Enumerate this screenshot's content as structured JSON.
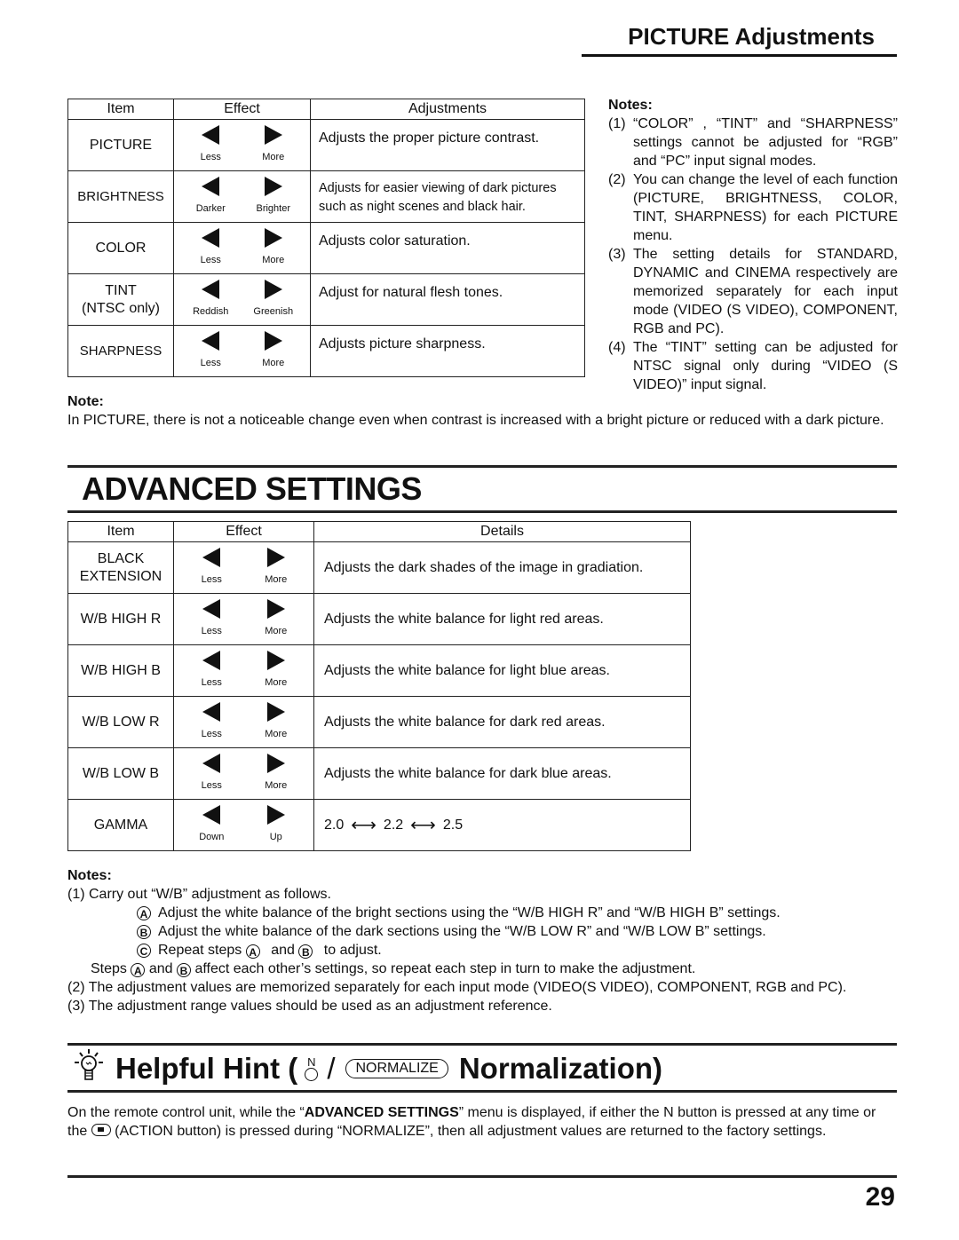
{
  "picture_section": {
    "title": "PICTURE Adjustments",
    "table": {
      "headers": {
        "item": "Item",
        "effect": "Effect",
        "adjustments": "Adjustments"
      },
      "rows": [
        {
          "item": [
            "PICTURE"
          ],
          "left": "Less",
          "right": "More",
          "adjustment": "Adjusts the proper picture contrast."
        },
        {
          "item": [
            "BRIGHTNESS"
          ],
          "left": "Darker",
          "right": "Brighter",
          "adjustment": "Adjusts for easier viewing of dark pictures such as night scenes and black hair."
        },
        {
          "item": [
            "COLOR"
          ],
          "left": "Less",
          "right": "More",
          "adjustment": "Adjusts color saturation."
        },
        {
          "item": [
            "TINT",
            "(NTSC only)"
          ],
          "left": "Reddish",
          "right": "Greenish",
          "adjustment": "Adjust for natural flesh tones."
        },
        {
          "item": [
            "SHARPNESS"
          ],
          "left": "Less",
          "right": "More",
          "adjustment": "Adjusts picture sharpness."
        }
      ]
    },
    "notes_heading": "Notes:",
    "notes": [
      {
        "num": "(1)",
        "text": "“COLOR” , “TINT” and “SHARPNESS” settings cannot be adjusted for “RGB” and “PC” input signal modes."
      },
      {
        "num": "(2)",
        "text": "You can change the level of each function (PICTURE, BRIGHTNESS, COLOR, TINT, SHARPNESS) for each PICTURE menu."
      },
      {
        "num": "(3)",
        "text": "The setting details for STANDARD, DYNAMIC and CINEMA respectively are memorized separately for each input mode (VIDEO (S VIDEO), COMPONENT, RGB and PC)."
      },
      {
        "num": "(4)",
        "text": "The “TINT” setting can be adjusted for NTSC signal only during “VIDEO (S VIDEO)” input signal."
      }
    ],
    "note_heading": "Note:",
    "note_text": "In PICTURE, there is not a noticeable change even when contrast is increased with a bright picture or reduced with a dark picture."
  },
  "advanced_section": {
    "title": "ADVANCED SETTINGS",
    "table": {
      "headers": {
        "item": "Item",
        "effect": "Effect",
        "details": "Details"
      },
      "rows": [
        {
          "item": [
            "BLACK",
            "EXTENSION"
          ],
          "left": "Less",
          "right": "More",
          "details": "Adjusts the dark shades of the image in gradiation."
        },
        {
          "item": [
            "W/B HIGH R"
          ],
          "left": "Less",
          "right": "More",
          "details": "Adjusts the white balance for light red areas."
        },
        {
          "item": [
            "W/B HIGH B"
          ],
          "left": "Less",
          "right": "More",
          "details": "Adjusts the white balance for light blue areas."
        },
        {
          "item": [
            "W/B LOW R"
          ],
          "left": "Less",
          "right": "More",
          "details": "Adjusts the white balance for dark red areas."
        },
        {
          "item": [
            "W/B LOW B"
          ],
          "left": "Less",
          "right": "More",
          "details": "Adjusts the white balance for dark blue areas."
        },
        {
          "item": [
            "GAMMA"
          ],
          "left": "Down",
          "right": "Up",
          "gamma_values": [
            "2.0",
            "2.2",
            "2.5"
          ],
          "gamma_arrow": "⟷"
        }
      ]
    },
    "notes_heading": "Notes:",
    "note1": "(1) Carry out “W/B” adjustment as follows.",
    "steps": [
      {
        "mark": "A",
        "text": "Adjust the white balance of the bright sections using the “W/B HIGH R” and “W/B HIGH B” settings."
      },
      {
        "mark": "B",
        "text": "Adjust the white balance of the dark sections using the “W/B LOW R” and “W/B LOW B” settings."
      },
      {
        "mark": "C",
        "text_before": "Repeat steps",
        "mark_a": "A",
        "text_mid": "and",
        "mark_b": "B",
        "text_after": "to adjust."
      }
    ],
    "steps_summary": {
      "before": "Steps",
      "mark_a": "A",
      "mid": "and",
      "mark_b": "B",
      "after": "affect each other’s settings, so repeat each step in turn to make the adjustment."
    },
    "note2": "(2) The adjustment values are memorized separately for each input mode (VIDEO(S VIDEO), COMPONENT, RGB and PC).",
    "note3": "(3) The adjustment range values should be used as an adjustment reference."
  },
  "hint_section": {
    "icon": "lightbulb-icon",
    "title_start": "Helpful Hint (",
    "n_button_label": "N",
    "slash": "/",
    "normalize_button_label": "NORMALIZE",
    "title_end": "Normalization)",
    "body": {
      "part1": "On the remote control unit, while the “",
      "bold": "ADVANCED SETTINGS",
      "part2": "” menu is displayed, if either the N button is pressed at any time or the",
      "part3": "(ACTION button) is pressed during “NORMALIZE”, then all adjustment values are returned to the factory settings."
    }
  },
  "page_number": "29"
}
